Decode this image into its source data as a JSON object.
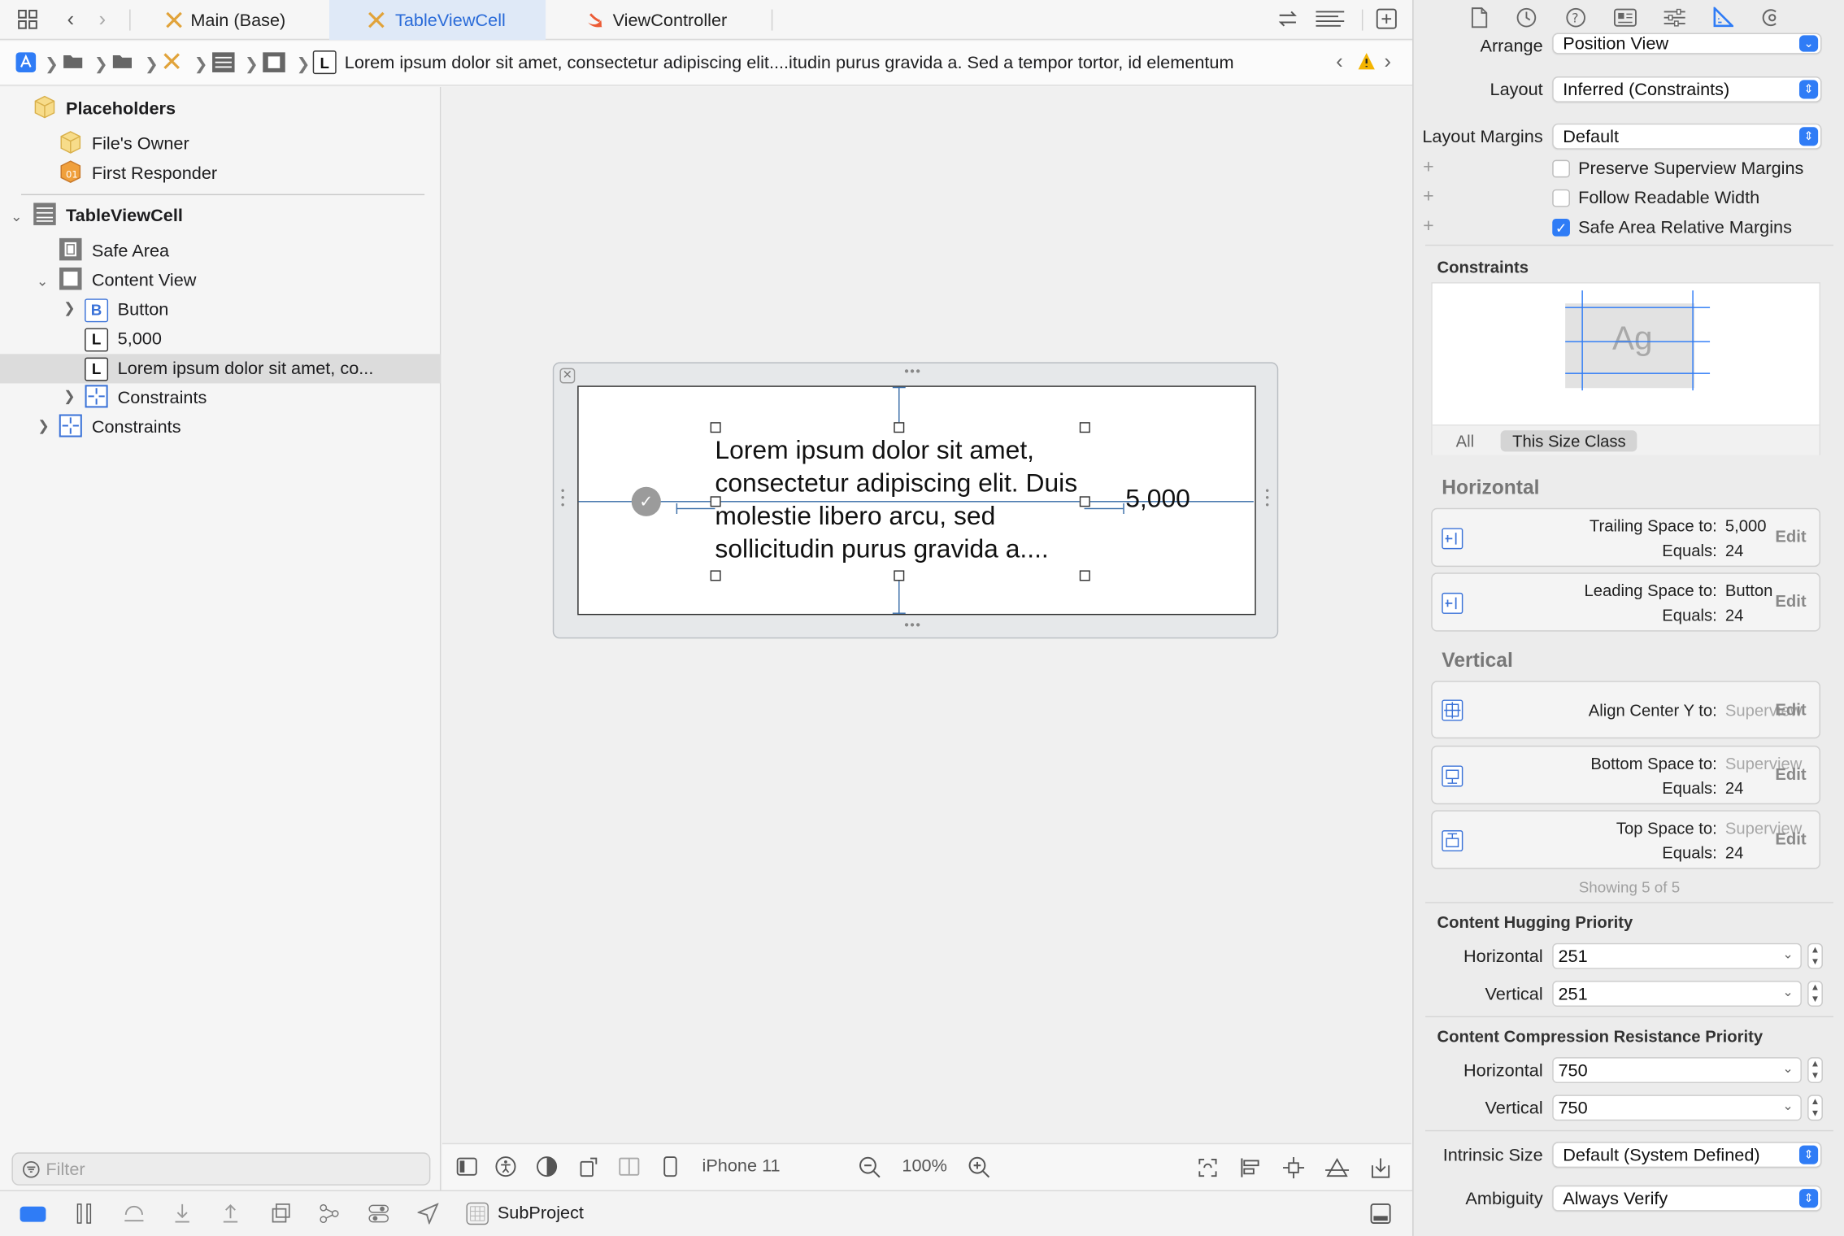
{
  "tabs": [
    {
      "label": "Main (Base)",
      "icon": "storyboard-icon"
    },
    {
      "label": "TableViewCell",
      "icon": "xib-icon",
      "active": true
    },
    {
      "label": "ViewController",
      "icon": "swift-icon"
    }
  ],
  "jumpbar": {
    "path_text": "Lorem ipsum dolor sit amet, consectetur adipiscing elit....itudin purus gravida a. Sed a tempor tortor, id elementum"
  },
  "navigator": {
    "placeholders": "Placeholders",
    "files_owner": "File's Owner",
    "first_responder": "First Responder",
    "cell": "TableViewCell",
    "safe_area": "Safe Area",
    "content_view": "Content View",
    "button": "Button",
    "price_label": "5,000",
    "lorem_label": "Lorem ipsum dolor sit amet, co...",
    "constraints_inner": "Constraints",
    "constraints_outer": "Constraints",
    "label_glyph": "L",
    "button_glyph": "B",
    "filter_placeholder": "Filter"
  },
  "canvas": {
    "cell_text": "Lorem ipsum dolor sit amet, consectetur adipiscing elit. Duis molestie libero arcu, sed sollicitudin purus gravida a....",
    "price": "5,000",
    "device": "iPhone 11",
    "zoom": "100%"
  },
  "bottombar": {
    "scheme": "SubProject"
  },
  "inspector": {
    "arrange_label": "Arrange",
    "arrange_value": "Position View",
    "layout_label": "Layout",
    "layout_value": "Inferred (Constraints)",
    "margins_label": "Layout Margins",
    "margins_value": "Default",
    "preserve": "Preserve Superview Margins",
    "follow": "Follow Readable Width",
    "safe_area_margins": "Safe Area Relative Margins",
    "constraints_title": "Constraints",
    "preview_text": "Ag",
    "seg_all": "All",
    "seg_size_class": "This Size Class",
    "horizontal": "Horizontal",
    "vertical": "Vertical",
    "edit": "Edit",
    "equals": "Equals:",
    "c1_label": "Trailing Space to:",
    "c1_target": "5,000",
    "c1_val": "24",
    "c2_label": "Leading Space to:",
    "c2_target": "Button",
    "c2_val": "24",
    "c3_label": "Align Center Y to:",
    "c3_target": "Superview",
    "c4_label": "Bottom Space to:",
    "c4_target": "Superview",
    "c4_val": "24",
    "c5_label": "Top Space to:",
    "c5_target": "Superview",
    "c5_val": "24",
    "showing": "Showing 5 of 5",
    "hugging_title": "Content Hugging Priority",
    "compression_title": "Content Compression Resistance Priority",
    "h_label": "Horizontal",
    "v_label": "Vertical",
    "hug_h": "251",
    "hug_v": "251",
    "comp_h": "750",
    "comp_v": "750",
    "intrinsic_label": "Intrinsic Size",
    "intrinsic_value": "Default (System Defined)",
    "ambiguity_label": "Ambiguity",
    "ambiguity_value": "Always Verify"
  },
  "colors": {
    "accent": "#2f7cf6",
    "selection_tab": "#dfe9f7",
    "constraint_line": "#3b6ea8"
  }
}
